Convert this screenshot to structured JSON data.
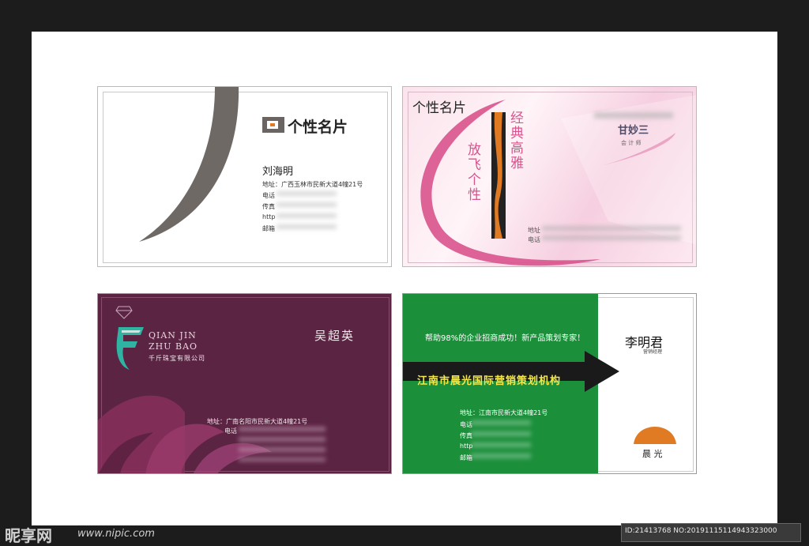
{
  "card1": {
    "logo_title": "个性名片",
    "name": "刘海明",
    "address": "地址：广西玉林市民新大道4幢21号",
    "phone_label": "电话",
    "fax_label": "传真",
    "url_label": "http",
    "email_label": "邮箱",
    "arc_color": "#6f6966"
  },
  "card2": {
    "title": "个性名片",
    "slogan1": "经典高雅",
    "slogan2": "放飞个性",
    "name": "甘妙三",
    "position": "会 计 师",
    "address_label": "地址",
    "phone_label": "电话",
    "accent_color": "#d9538d"
  },
  "card3": {
    "brand_line1": "QIAN JIN",
    "brand_line2": "ZHU BAO",
    "company": "千斤珠宝有限公司",
    "name": "吴超英",
    "address": "地址：广南名阳市民新大道4幢21号",
    "phone_label": "电话",
    "bg_color": "#5c2443"
  },
  "card4": {
    "slogan": "帮助98%的企业招商成功！新产品策划专家！",
    "banner": "江南市晨光国际营销策划机构",
    "name": "李明君",
    "position": "营销经理",
    "address": "地址：江南市民新大道4幢21号",
    "phone_label": "电话",
    "fax_label": "传真",
    "url_label": "http",
    "email_label": "邮箱",
    "logo_text": "晨 光",
    "green": "#1c8f3b",
    "banner_text_color": "#f5e84a"
  },
  "watermark": {
    "site": "昵享网",
    "url": "www.nipic.com",
    "id_info": "ID:21413768 NO:20191115114943323000"
  }
}
